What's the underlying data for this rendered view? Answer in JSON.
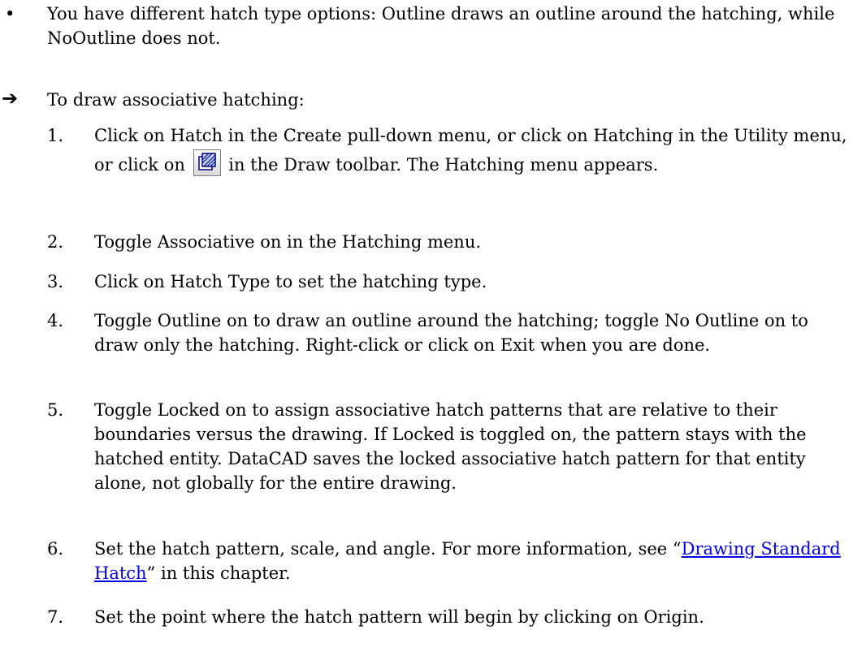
{
  "intro_bullet": {
    "dot": "•",
    "text": "You have different hatch type options: Outline draws an outline around the hatching, while NoOutline does not."
  },
  "procedure": {
    "arrow": "➔",
    "title": "To draw associative hatching:"
  },
  "steps": [
    {
      "number": "1.",
      "before": "Click on Hatch in the Create pull-down menu, or click on Hatching in the Utility menu, or click on",
      "icon": "hatch-toolbar-icon",
      "after": "in the Draw toolbar. The Hatching menu appears."
    },
    {
      "number": "2.",
      "text": "Toggle Associative on in the Hatching menu."
    },
    {
      "number": "3.",
      "text": "Click on Hatch Type to set the hatching type."
    },
    {
      "number": "4.",
      "text": "Toggle Outline on to draw an outline around the hatching; toggle No Outline on to draw only the hatching. Right-click or click on Exit when you are done."
    },
    {
      "number": "5.",
      "text": "Toggle Locked on to assign associative hatch patterns that are relative to their boundaries versus the drawing. If Locked is toggled on, the pattern stays with the hatched entity. DataCAD saves the locked associative hatch pattern for that entity alone, not globally for the entire drawing."
    },
    {
      "number": "6.",
      "before": "Set the hatch pattern, scale, and angle. For more information, see “",
      "link": "Drawing Standard Hatch",
      "after": "” in this chapter."
    },
    {
      "number": "7.",
      "text": "Set the point where the hatch pattern will begin by clicking on Origin."
    }
  ]
}
